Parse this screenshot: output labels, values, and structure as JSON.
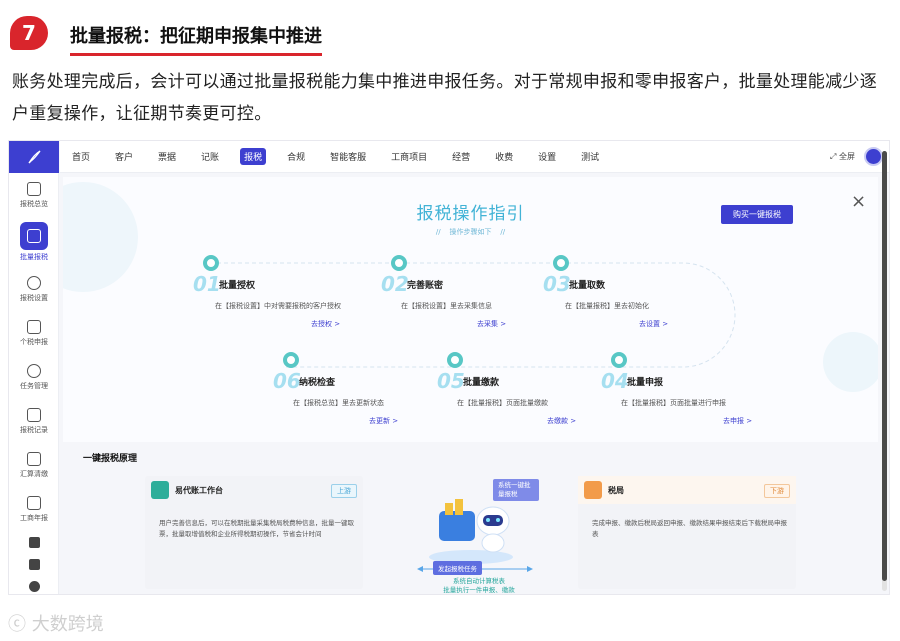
{
  "article": {
    "number": "7",
    "title": "批量报税：把征期申报集中推进",
    "body": "账务处理完成后，会计可以通过批量报税能力集中推进申报任务。对于常规申报和零申报客户，批量处理能减少逐户重复操作，让征期节奏更可控。"
  },
  "sidebar": {
    "items": [
      {
        "label": "报税总览",
        "icon": "overview-icon"
      },
      {
        "label": "批量报税",
        "icon": "batch-tax-icon",
        "active": true
      },
      {
        "label": "报税设置",
        "icon": "gear-icon"
      },
      {
        "label": "个税申报",
        "icon": "document-icon"
      },
      {
        "label": "任务管理",
        "icon": "share-icon"
      },
      {
        "label": "报税记录",
        "icon": "record-icon"
      },
      {
        "label": "汇算清缴",
        "icon": "grid-icon"
      },
      {
        "label": "工商年报",
        "icon": "report-icon"
      }
    ]
  },
  "topnav": {
    "items": [
      "首页",
      "客户",
      "票据",
      "记账",
      "报税",
      "合规",
      "智能客服",
      "工商项目",
      "经营",
      "收费",
      "设置",
      "测试"
    ],
    "active": "报税",
    "fullscreen": "全屏"
  },
  "guide": {
    "title": "报税操作指引",
    "subtitle": "操作步骤如下",
    "buy_button": "购买一键报税",
    "close": "×",
    "steps": [
      {
        "num": "01",
        "title": "批量授权",
        "desc": "在【报税设置】中对需要报税的客户授权",
        "link": "去授权 >"
      },
      {
        "num": "02",
        "title": "完善账密",
        "desc": "在【报税设置】里去采集信息",
        "link": "去采集 >"
      },
      {
        "num": "03",
        "title": "批量取数",
        "desc": "在【批量报税】里去初始化",
        "link": "去设置 >"
      },
      {
        "num": "04",
        "title": "批量申报",
        "desc": "在【批量报税】页面批量进行申报",
        "link": "去申报 >"
      },
      {
        "num": "05",
        "title": "批量缴款",
        "desc": "在【批量报税】页面批量缴款",
        "link": "去缴款 >"
      },
      {
        "num": "06",
        "title": "纳税检查",
        "desc": "在【报税总览】里去更新状态",
        "link": "去更新 >"
      }
    ]
  },
  "principle": {
    "title": "一键报税原理",
    "left_card": {
      "name": "易代账工作台",
      "tag": "上游",
      "body": "用户完善信息后，可以在税期批量采集税局税费种信息，批量一键取票，批量取增值税和企业所得税期初操作，节省会计时间"
    },
    "right_card": {
      "name": "税局",
      "tag": "下游",
      "body": "完成申报、缴款后税局返回申报、缴款结果申报结束后下载税局申报表"
    },
    "center": {
      "tag_top": "系统一键批量报税",
      "tag_mid": "发起报税任务",
      "line1": "系统自动计算税表",
      "line2": "批量执行一件申报、缴款"
    }
  },
  "watermark": "大数跨境",
  "colors": {
    "accent": "#3d3fd0",
    "teal": "#58c7c5",
    "title_red": "#d9252c"
  }
}
